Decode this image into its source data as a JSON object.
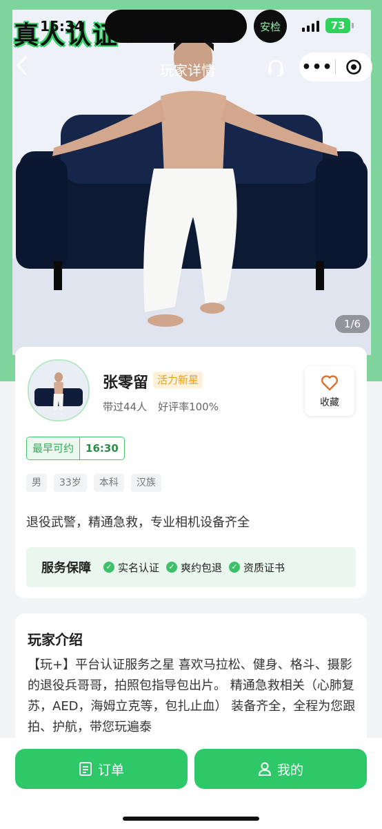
{
  "status_bar": {
    "time": "15:34",
    "badge": "安检",
    "battery": "73"
  },
  "logo": {
    "text": "真人认证",
    "icon": "airplane-icon"
  },
  "nav": {
    "title": "玩家详情",
    "back_icon": "chevron-left-icon",
    "service_icon": "headset-icon",
    "more_icon": "more-dots-icon",
    "close_icon": "target-icon"
  },
  "gallery": {
    "counter": "1/6"
  },
  "profile": {
    "name": "张零留",
    "tag": "活力新星",
    "served": "带过44人",
    "rating": "好评率100%",
    "favorite_label": "收藏",
    "earliest_label": "最早可约",
    "earliest_time": "16:30",
    "tags": [
      "男",
      "33岁",
      "本科",
      "汉族"
    ],
    "bio": "退役武警，精通急救，专业相机设备齐全"
  },
  "guarantee": {
    "title": "服务保障",
    "items": [
      "实名认证",
      "爽约包退",
      "资质证书"
    ]
  },
  "intro": {
    "title": "玩家介绍",
    "text": "【玩+】平台认证服务之星 喜欢马拉松、健身、格斗、摄影的退役兵哥哥，拍照包指导包出片。 精通急救相关（心肺复苏，AED，海姆立克等，包扎止血） 装备齐全，全程为您跟拍、护航，带您玩遍泰"
  },
  "bottom": {
    "order_label": "订单",
    "mine_label": "我的"
  },
  "colors": {
    "accent": "#2ec868",
    "frame": "#7fd49c",
    "tag_gold": "#e3a026"
  }
}
